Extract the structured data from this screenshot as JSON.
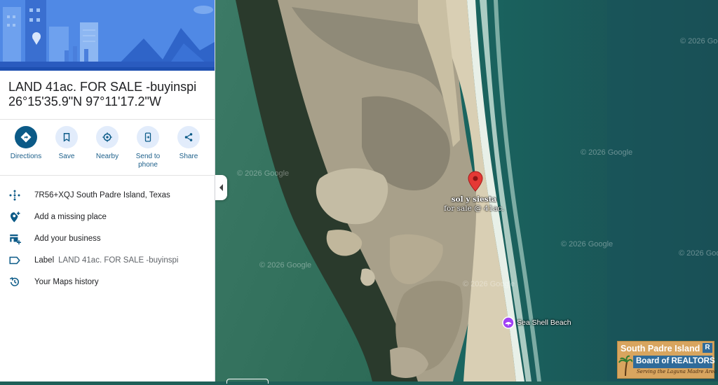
{
  "place": {
    "title": "LAND 41ac. FOR SALE -buyinspi",
    "coordinates": "26°15'35.9\"N 97°11'17.2\"W"
  },
  "actions": [
    {
      "label": "Directions",
      "icon": "directions-icon"
    },
    {
      "label": "Save",
      "icon": "bookmark-icon"
    },
    {
      "label": "Nearby",
      "icon": "nearby-icon"
    },
    {
      "label_line1": "Send to",
      "label_line2": "phone",
      "icon": "send-to-phone-icon"
    },
    {
      "label": "Share",
      "icon": "share-icon"
    }
  ],
  "info": {
    "plus_code": "7R56+XQJ South Padre Island, Texas",
    "missing_place": "Add a missing place",
    "add_business": "Add your business",
    "label_prefix": "Label",
    "label_value": "LAND 41ac. FOR SALE -buyinspi",
    "history": "Your Maps history"
  },
  "map": {
    "custom_label_line1": "sol y siesta",
    "custom_label_line2": "for sale @ 41ac.",
    "poi_name": "Sea Shell Beach",
    "watermark": "© 2026 Google",
    "pin_color": "#e53935",
    "poi_color": "#a142f4"
  },
  "badge": {
    "line1": "South Padre Island",
    "line2": "Board of REALTORS",
    "tagline": "Serving the Laguna Madre Area"
  },
  "colors": {
    "primary_action": "#0b5a87",
    "action_bg": "#e2ecfb",
    "hero_bg": "#4a82e0"
  }
}
